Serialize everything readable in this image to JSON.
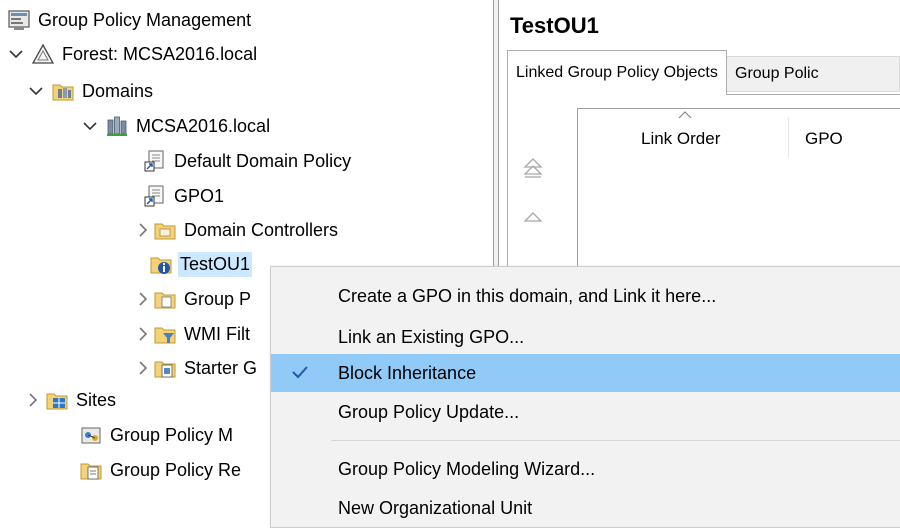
{
  "tree": {
    "root_label": "Group Policy Management",
    "forest_label": "Forest: MCSA2016.local",
    "domains_label": "Domains",
    "domain_label": "MCSA2016.local",
    "default_policy_label": "Default Domain Policy",
    "gpo1_label": "GPO1",
    "domain_controllers_label": "Domain Controllers",
    "testou_label": "TestOU1",
    "group_policy_objects_label": "Group P",
    "wmi_filters_label": "WMI Filt",
    "starter_gpos_label": "Starter G",
    "sites_label": "Sites",
    "gp_modeling_label": "Group Policy M",
    "gp_results_label": "Group Policy Re"
  },
  "right_pane": {
    "title": "TestOU1",
    "tabs": [
      {
        "label": "Linked Group Policy Objects",
        "active": true
      },
      {
        "label": "Group Polic",
        "active": false
      }
    ],
    "columns": {
      "link_order": "Link Order",
      "gpo": "GPO"
    }
  },
  "context_menu": {
    "items": [
      {
        "label": "Create a GPO in this domain, and Link it here...",
        "checked": false,
        "highlighted": false
      },
      {
        "label": "Link an Existing GPO...",
        "checked": false,
        "highlighted": false
      },
      {
        "label": "Block Inheritance",
        "checked": true,
        "highlighted": true
      },
      {
        "label": "Group Policy Update...",
        "checked": false,
        "highlighted": false
      },
      {
        "label": "Group Policy Modeling Wizard...",
        "checked": false,
        "highlighted": false
      },
      {
        "label": "New Organizational Unit",
        "checked": false,
        "highlighted": false
      }
    ]
  },
  "colors": {
    "selection": "#cce8ff",
    "menu_highlight": "#91c9f7",
    "menu_background": "#f2f2f2",
    "check_mark": "#1e5aa8"
  },
  "icons": {
    "root": "gpm-console-icon",
    "forest": "forest-triangle-icon",
    "domains": "domains-folder-icon",
    "domain": "domain-icon",
    "gpo_link": "gpo-link-scroll-icon",
    "ou": "ou-folder-icon",
    "ou_blocked": "ou-blocked-inheritance-icon",
    "sites": "sites-icon",
    "modeling": "modeling-icon",
    "results": "results-icon"
  }
}
